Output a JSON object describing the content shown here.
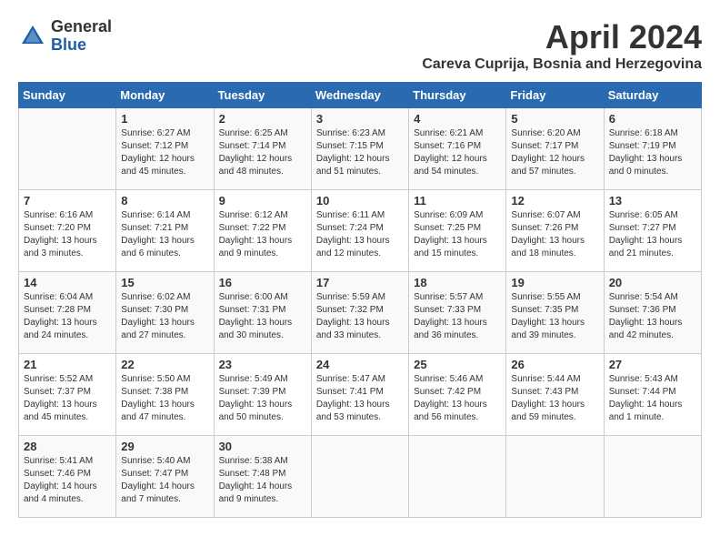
{
  "header": {
    "logo_general": "General",
    "logo_blue": "Blue",
    "month_title": "April 2024",
    "location": "Careva Cuprija, Bosnia and Herzegovina"
  },
  "columns": [
    "Sunday",
    "Monday",
    "Tuesday",
    "Wednesday",
    "Thursday",
    "Friday",
    "Saturday"
  ],
  "weeks": [
    {
      "days": [
        {
          "num": "",
          "lines": []
        },
        {
          "num": "1",
          "lines": [
            "Sunrise: 6:27 AM",
            "Sunset: 7:12 PM",
            "Daylight: 12 hours",
            "and 45 minutes."
          ]
        },
        {
          "num": "2",
          "lines": [
            "Sunrise: 6:25 AM",
            "Sunset: 7:14 PM",
            "Daylight: 12 hours",
            "and 48 minutes."
          ]
        },
        {
          "num": "3",
          "lines": [
            "Sunrise: 6:23 AM",
            "Sunset: 7:15 PM",
            "Daylight: 12 hours",
            "and 51 minutes."
          ]
        },
        {
          "num": "4",
          "lines": [
            "Sunrise: 6:21 AM",
            "Sunset: 7:16 PM",
            "Daylight: 12 hours",
            "and 54 minutes."
          ]
        },
        {
          "num": "5",
          "lines": [
            "Sunrise: 6:20 AM",
            "Sunset: 7:17 PM",
            "Daylight: 12 hours",
            "and 57 minutes."
          ]
        },
        {
          "num": "6",
          "lines": [
            "Sunrise: 6:18 AM",
            "Sunset: 7:19 PM",
            "Daylight: 13 hours",
            "and 0 minutes."
          ]
        }
      ]
    },
    {
      "days": [
        {
          "num": "7",
          "lines": [
            "Sunrise: 6:16 AM",
            "Sunset: 7:20 PM",
            "Daylight: 13 hours",
            "and 3 minutes."
          ]
        },
        {
          "num": "8",
          "lines": [
            "Sunrise: 6:14 AM",
            "Sunset: 7:21 PM",
            "Daylight: 13 hours",
            "and 6 minutes."
          ]
        },
        {
          "num": "9",
          "lines": [
            "Sunrise: 6:12 AM",
            "Sunset: 7:22 PM",
            "Daylight: 13 hours",
            "and 9 minutes."
          ]
        },
        {
          "num": "10",
          "lines": [
            "Sunrise: 6:11 AM",
            "Sunset: 7:24 PM",
            "Daylight: 13 hours",
            "and 12 minutes."
          ]
        },
        {
          "num": "11",
          "lines": [
            "Sunrise: 6:09 AM",
            "Sunset: 7:25 PM",
            "Daylight: 13 hours",
            "and 15 minutes."
          ]
        },
        {
          "num": "12",
          "lines": [
            "Sunrise: 6:07 AM",
            "Sunset: 7:26 PM",
            "Daylight: 13 hours",
            "and 18 minutes."
          ]
        },
        {
          "num": "13",
          "lines": [
            "Sunrise: 6:05 AM",
            "Sunset: 7:27 PM",
            "Daylight: 13 hours",
            "and 21 minutes."
          ]
        }
      ]
    },
    {
      "days": [
        {
          "num": "14",
          "lines": [
            "Sunrise: 6:04 AM",
            "Sunset: 7:28 PM",
            "Daylight: 13 hours",
            "and 24 minutes."
          ]
        },
        {
          "num": "15",
          "lines": [
            "Sunrise: 6:02 AM",
            "Sunset: 7:30 PM",
            "Daylight: 13 hours",
            "and 27 minutes."
          ]
        },
        {
          "num": "16",
          "lines": [
            "Sunrise: 6:00 AM",
            "Sunset: 7:31 PM",
            "Daylight: 13 hours",
            "and 30 minutes."
          ]
        },
        {
          "num": "17",
          "lines": [
            "Sunrise: 5:59 AM",
            "Sunset: 7:32 PM",
            "Daylight: 13 hours",
            "and 33 minutes."
          ]
        },
        {
          "num": "18",
          "lines": [
            "Sunrise: 5:57 AM",
            "Sunset: 7:33 PM",
            "Daylight: 13 hours",
            "and 36 minutes."
          ]
        },
        {
          "num": "19",
          "lines": [
            "Sunrise: 5:55 AM",
            "Sunset: 7:35 PM",
            "Daylight: 13 hours",
            "and 39 minutes."
          ]
        },
        {
          "num": "20",
          "lines": [
            "Sunrise: 5:54 AM",
            "Sunset: 7:36 PM",
            "Daylight: 13 hours",
            "and 42 minutes."
          ]
        }
      ]
    },
    {
      "days": [
        {
          "num": "21",
          "lines": [
            "Sunrise: 5:52 AM",
            "Sunset: 7:37 PM",
            "Daylight: 13 hours",
            "and 45 minutes."
          ]
        },
        {
          "num": "22",
          "lines": [
            "Sunrise: 5:50 AM",
            "Sunset: 7:38 PM",
            "Daylight: 13 hours",
            "and 47 minutes."
          ]
        },
        {
          "num": "23",
          "lines": [
            "Sunrise: 5:49 AM",
            "Sunset: 7:39 PM",
            "Daylight: 13 hours",
            "and 50 minutes."
          ]
        },
        {
          "num": "24",
          "lines": [
            "Sunrise: 5:47 AM",
            "Sunset: 7:41 PM",
            "Daylight: 13 hours",
            "and 53 minutes."
          ]
        },
        {
          "num": "25",
          "lines": [
            "Sunrise: 5:46 AM",
            "Sunset: 7:42 PM",
            "Daylight: 13 hours",
            "and 56 minutes."
          ]
        },
        {
          "num": "26",
          "lines": [
            "Sunrise: 5:44 AM",
            "Sunset: 7:43 PM",
            "Daylight: 13 hours",
            "and 59 minutes."
          ]
        },
        {
          "num": "27",
          "lines": [
            "Sunrise: 5:43 AM",
            "Sunset: 7:44 PM",
            "Daylight: 14 hours",
            "and 1 minute."
          ]
        }
      ]
    },
    {
      "days": [
        {
          "num": "28",
          "lines": [
            "Sunrise: 5:41 AM",
            "Sunset: 7:46 PM",
            "Daylight: 14 hours",
            "and 4 minutes."
          ]
        },
        {
          "num": "29",
          "lines": [
            "Sunrise: 5:40 AM",
            "Sunset: 7:47 PM",
            "Daylight: 14 hours",
            "and 7 minutes."
          ]
        },
        {
          "num": "30",
          "lines": [
            "Sunrise: 5:38 AM",
            "Sunset: 7:48 PM",
            "Daylight: 14 hours",
            "and 9 minutes."
          ]
        },
        {
          "num": "",
          "lines": []
        },
        {
          "num": "",
          "lines": []
        },
        {
          "num": "",
          "lines": []
        },
        {
          "num": "",
          "lines": []
        }
      ]
    }
  ]
}
